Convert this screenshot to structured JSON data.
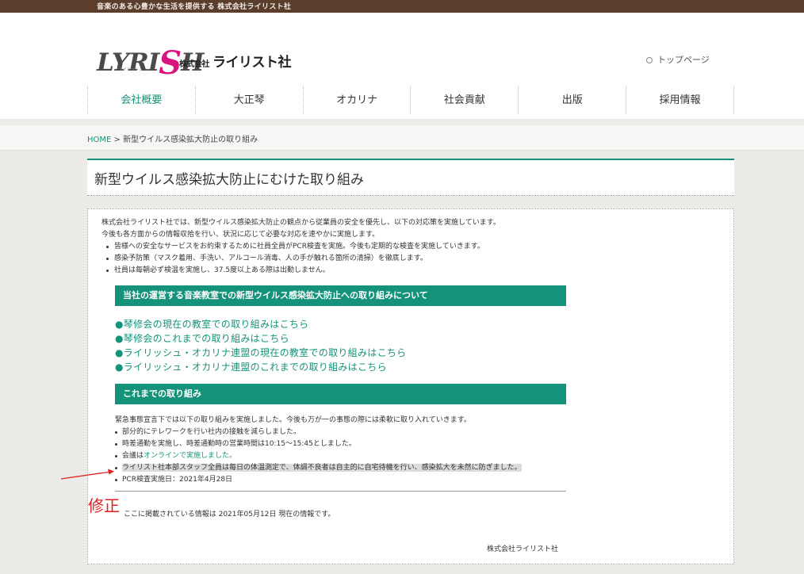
{
  "topbar": {
    "tagline": "音楽のある心豊かな生活を提供する 株式会社ライリスト社"
  },
  "header": {
    "logo_text_start": "LYRI",
    "logo_text_accent": "S",
    "logo_text_end": "H",
    "logo_subtext": "ライリッシュ",
    "company_prefix": "株式会社",
    "company_name": "ライリスト社",
    "top_link": "トップページ"
  },
  "nav": {
    "items": [
      {
        "label": "会社概要"
      },
      {
        "label": "大正琴"
      },
      {
        "label": "オカリナ"
      },
      {
        "label": "社会貢献"
      },
      {
        "label": "出版"
      },
      {
        "label": "採用情報"
      }
    ]
  },
  "breadcrumb": {
    "home": "HOME",
    "separator": ">",
    "current": "新型ウイルス感染拡大防止の取り組み"
  },
  "page_title": "新型ウイルス感染拡大防止にむけた取り組み",
  "intro": {
    "p1": "株式会社ライリスト社では、新型ウイルス感染拡大防止の観点から従業員の安全を優先し、以下の対応策を実施しています。",
    "p2": "今後も各方面からの情報収拾を行い、状況に応じて必要な対応を速やかに実施します。",
    "bullets": [
      "皆様への安全なサービスをお約束するために社員全員がPCR検査を実施。今後も定期的な検査を実施していきます。",
      "感染予防策（マスク着用、手洗い、アルコール消毒、人の手が触れる箇所の清掃）を徹底します。",
      "社員は毎朝必ず検温を実施し、37.5度以上ある際は出勤しません。"
    ]
  },
  "section1": {
    "heading": "当社の運営する音楽教室での新型ウイルス感染拡大防止への取り組みについて",
    "links": [
      "●琴修会の現在の教室での取り組みはこちら",
      "●琴修会のこれまでの取り組みはこちら",
      "●ライリッシュ・オカリナ連盟の現在の教室での取り組みはこちら",
      "●ライリッシュ・オカリナ連盟のこれまでの取り組みはこちら"
    ]
  },
  "section2": {
    "heading": "これまでの取り組み",
    "lead": "緊急事態宣言下では以下の取り組みを実施しました。今後も万が一の事態の際には柔軟に取り入れていきます。",
    "bullet1": "部分的にテレワークを行い社内の接触を減らしました。",
    "bullet2": "時差通勤を実施し、時差通勤時の営業時間は10:15〜15:45としました。",
    "bullet3_prefix": "会議は",
    "bullet3_link": "オンラインで実施しました。",
    "bullet4": "ライリスト社本部スタッフ全員は毎日の体温測定で、体調不良者は自主的に自宅待機を行い、感染拡大を未然に防ぎました。",
    "bullet5": "PCR検査実施日：2021年4月28日"
  },
  "updated": "ここに掲載されている情報は 2021年05月12日 現在の情報です。",
  "signoff": "株式会社ライリスト社",
  "annotation": "修正",
  "colors": {
    "accent": "#15937a",
    "topbar": "#5a3d2b",
    "annotation": "#e02020"
  }
}
